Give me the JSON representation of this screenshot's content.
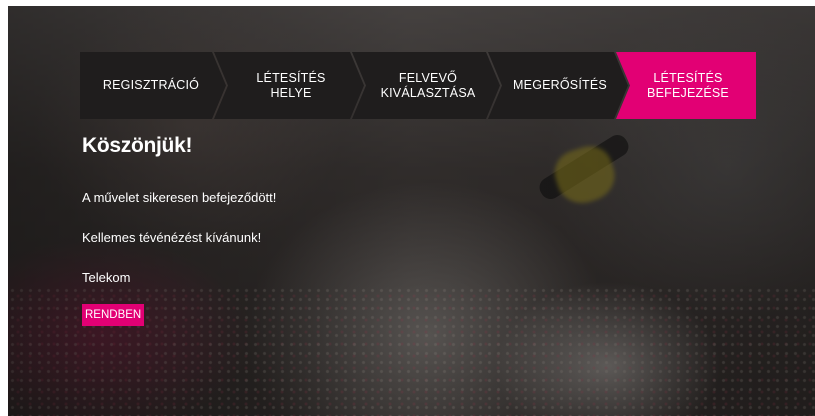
{
  "stepper": {
    "steps": [
      {
        "lines": [
          "REGISZTRÁCIÓ"
        ],
        "active": false
      },
      {
        "lines": [
          "LÉTESÍTÉS",
          "HELYE"
        ],
        "active": false
      },
      {
        "lines": [
          "FELVEVŐ",
          "KIVÁLASZTÁSA"
        ],
        "active": false
      },
      {
        "lines": [
          "MEGERŐSÍTÉS"
        ],
        "active": false
      },
      {
        "lines": [
          "LÉTESÍTÉS",
          "BEFEJEZÉSE"
        ],
        "active": true
      }
    ]
  },
  "content": {
    "title": "Köszönjük!",
    "message": "A művelet sikeresen befejeződött!",
    "wish": "Kellemes tévénézést kívánunk!",
    "signature": "Telekom",
    "ok_label": "RENDBEN"
  },
  "colors": {
    "accent": "#e20074",
    "step_bg": "#1f1d1d",
    "text": "#ffffff"
  }
}
